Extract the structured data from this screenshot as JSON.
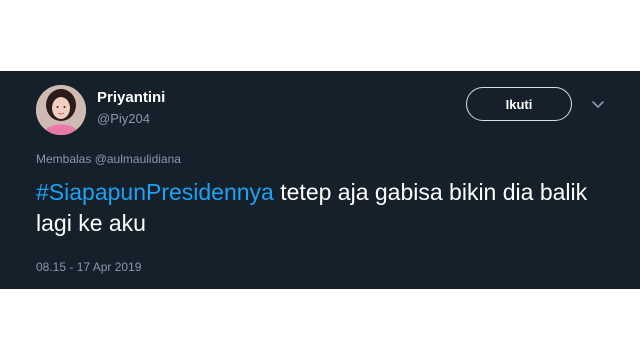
{
  "user": {
    "display_name": "Priyantini",
    "handle": "@Piy204",
    "avatar_icon": "profile-photo"
  },
  "follow_button": {
    "label": "Ikuti"
  },
  "menu": {
    "icon": "chevron-down-icon"
  },
  "reply": {
    "prefix": "Membalas",
    "mention": "@aulmaulidiana"
  },
  "tweet": {
    "hashtag": "#SiapapunPresidennya",
    "text": " tetep aja gabisa bikin dia balik lagi ke aku"
  },
  "meta": {
    "timestamp": "08.15 - 17 Apr 2019"
  },
  "colors": {
    "background": "#15202b",
    "link": "#1da1f2",
    "secondary_text": "#8899a6"
  }
}
